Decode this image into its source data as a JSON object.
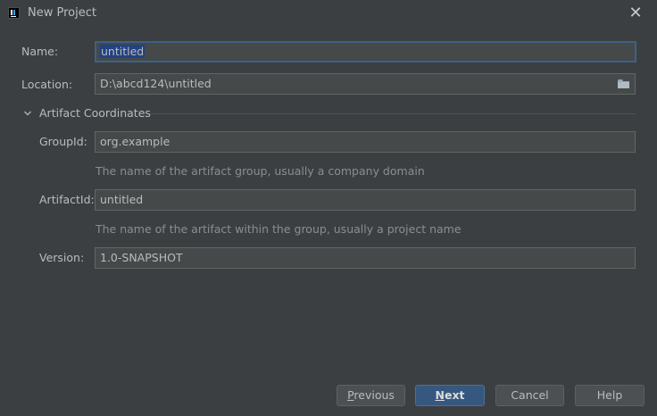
{
  "window": {
    "title": "New Project",
    "close_glyph": "✕"
  },
  "form": {
    "name_label": "Name:",
    "name_value": "untitled",
    "location_label": "Location:",
    "location_value": "D:\\abcd124\\untitled",
    "section_title": "Artifact Coordinates",
    "groupid_label": "GroupId:",
    "groupid_value": "org.example",
    "groupid_hint": "The name of the artifact group, usually a company domain",
    "artifactid_label": "ArtifactId:",
    "artifactid_value": "untitled",
    "artifactid_hint": "The name of the artifact within the group, usually a project name",
    "version_label": "Version:",
    "version_value": "1.0-SNAPSHOT"
  },
  "buttons": {
    "previous_mnemonic": "P",
    "previous_rest": "revious",
    "next_mnemonic": "N",
    "next_rest": "ext",
    "cancel_label": "Cancel",
    "help_label": "Help"
  },
  "icons": {
    "app": "intellij-app-icon",
    "close": "close-icon",
    "folder": "folder-icon",
    "chevron": "chevron-down-icon"
  },
  "colors": {
    "background": "#3c3f41",
    "field_background": "#45494a",
    "field_border": "#646464",
    "focus_border": "#3d6185",
    "selection": "#214283",
    "primary_button": "#365880",
    "hint_text": "#8c8c8c"
  }
}
